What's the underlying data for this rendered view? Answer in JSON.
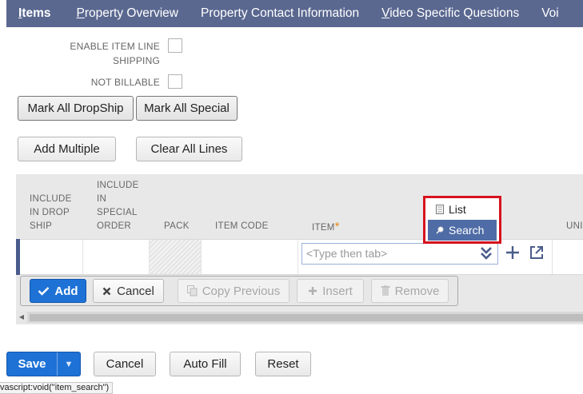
{
  "tabs": [
    {
      "label": "Items",
      "accel": "I",
      "rest": "tems",
      "active": true
    },
    {
      "label": "Property Overview",
      "accel": "P",
      "rest": "roperty Overview"
    },
    {
      "label": "Property Contact Information",
      "accel": "",
      "rest": "Property Contact Information"
    },
    {
      "label": "Video Specific Questions",
      "accel": "V",
      "rest": "ideo Specific Questions"
    },
    {
      "label": "Voi",
      "accel": "",
      "rest": "Voi"
    }
  ],
  "fields": {
    "enable_item_line_shipping": {
      "label_line1": "ENABLE ITEM LINE",
      "label_line2": "SHIPPING",
      "checked": false
    },
    "not_billable": {
      "label": "NOT BILLABLE",
      "checked": false
    }
  },
  "buttons": {
    "mark_all_dropship": "Mark All DropShip",
    "mark_all_special": "Mark All Special",
    "add_multiple": "Add Multiple",
    "clear_all_lines": "Clear All Lines"
  },
  "columns": {
    "include_drop_ship": [
      "INCLUDE",
      "IN DROP",
      "SHIP"
    ],
    "include_special": [
      "INCLUDE",
      "IN",
      "SPECIAL",
      "ORDER"
    ],
    "pack": "PACK",
    "item_code": "ITEM CODE",
    "item": "ITEM",
    "required_mark": "*",
    "uni": "UNI"
  },
  "item_input": {
    "placeholder": "<Type then tab>"
  },
  "popup_menu": {
    "list": "List",
    "search": "Search"
  },
  "toolbar": {
    "add": "Add",
    "cancel": "Cancel",
    "copy_previous": "Copy Previous",
    "insert": "Insert",
    "remove": "Remove"
  },
  "footer": {
    "save": "Save",
    "cancel": "Cancel",
    "auto_fill": "Auto Fill",
    "reset": "Reset"
  },
  "status_bar": "vascript:void(\"item_search\")",
  "colors": {
    "tab_bar": "#5a6890",
    "primary": "#1e72d6",
    "highlight_border": "#d6121d",
    "menu_selected": "#4f6ca6"
  }
}
